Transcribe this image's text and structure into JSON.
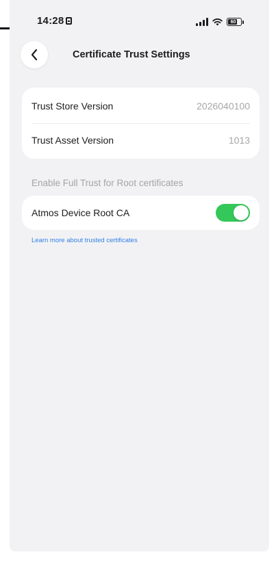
{
  "status_bar": {
    "time": "14:28",
    "battery_level": "60"
  },
  "nav": {
    "title": "Certificate Trust Settings",
    "back_icon": "chevron-left-icon"
  },
  "versions": {
    "rows": [
      {
        "label": "Trust Store Version",
        "value": "2026040100"
      },
      {
        "label": "Trust Asset Version",
        "value": "1013"
      }
    ]
  },
  "trust": {
    "section_header": "Enable Full Trust for Root certificates",
    "items": [
      {
        "label": "Atmos Device Root CA",
        "enabled": true
      }
    ],
    "learn_more": "Learn more about trusted certificates"
  },
  "colors": {
    "background": "#f2f2f4",
    "toggle_on": "#34c759",
    "link": "#2f7fe4"
  }
}
